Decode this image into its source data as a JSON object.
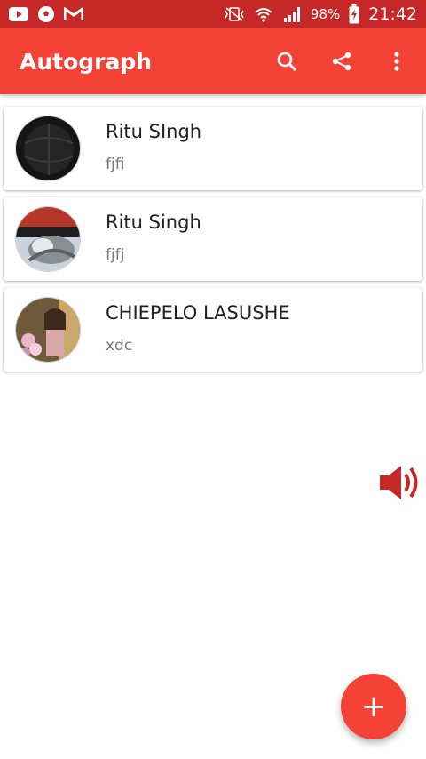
{
  "status_bar": {
    "battery_percent": "98%",
    "time": "21:42",
    "left_icons": [
      "youtube-icon",
      "soccer-ball-icon",
      "gmail-icon"
    ],
    "right_icons": [
      "vibrate-mute-icon",
      "wifi-icon",
      "signal-icon",
      "battery-charging-icon"
    ]
  },
  "app_bar": {
    "title": "Autograph",
    "actions": [
      "search-icon",
      "share-icon",
      "more-vert-icon"
    ],
    "color": "#f44336"
  },
  "cards": [
    {
      "name": "Ritu SIngh",
      "subtitle": "fjfi"
    },
    {
      "name": "Ritu Singh",
      "subtitle": "fjfj"
    },
    {
      "name": "CHIEPELO LASUSHE",
      "subtitle": "xdc"
    }
  ],
  "floating": {
    "speaker_icon": "volume-icon",
    "fab_label": "+"
  },
  "colors": {
    "primary": "#f44336",
    "status_bar": "#c62828",
    "speaker": "#c62828"
  }
}
